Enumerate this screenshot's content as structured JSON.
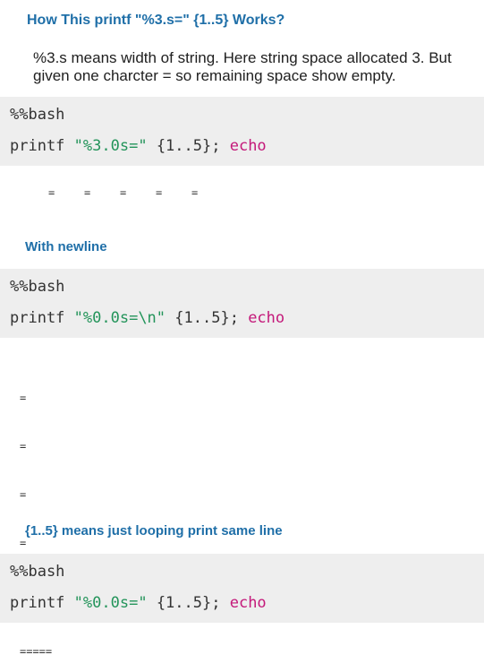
{
  "section1": {
    "heading": "How This printf \"%3.s=\" {1..5} Works?",
    "paragraph": "%3.s means width of string. Here string space allocated 3. But given one charcter = so remaining space show empty.",
    "cell": {
      "magic": "%%bash",
      "cmd": "printf",
      "str": "\"%3.0s=\"",
      "args": "{1..5};",
      "kw": "echo"
    },
    "output": [
      "=",
      "=",
      "=",
      "=",
      "="
    ]
  },
  "section2": {
    "heading": "With newline",
    "cell": {
      "magic": "%%bash",
      "cmd": "printf",
      "str": "\"%0.0s=\\n\"",
      "args": "{1..5};",
      "kw": "echo"
    },
    "output": [
      "=",
      "=",
      "=",
      "=",
      "="
    ]
  },
  "section3": {
    "heading": "{1..5} means just looping print same line",
    "cell": {
      "magic": "%%bash",
      "cmd": "printf",
      "str": "\"%0.0s=\"",
      "args": "{1..5};",
      "kw": "echo"
    },
    "output": "====="
  }
}
